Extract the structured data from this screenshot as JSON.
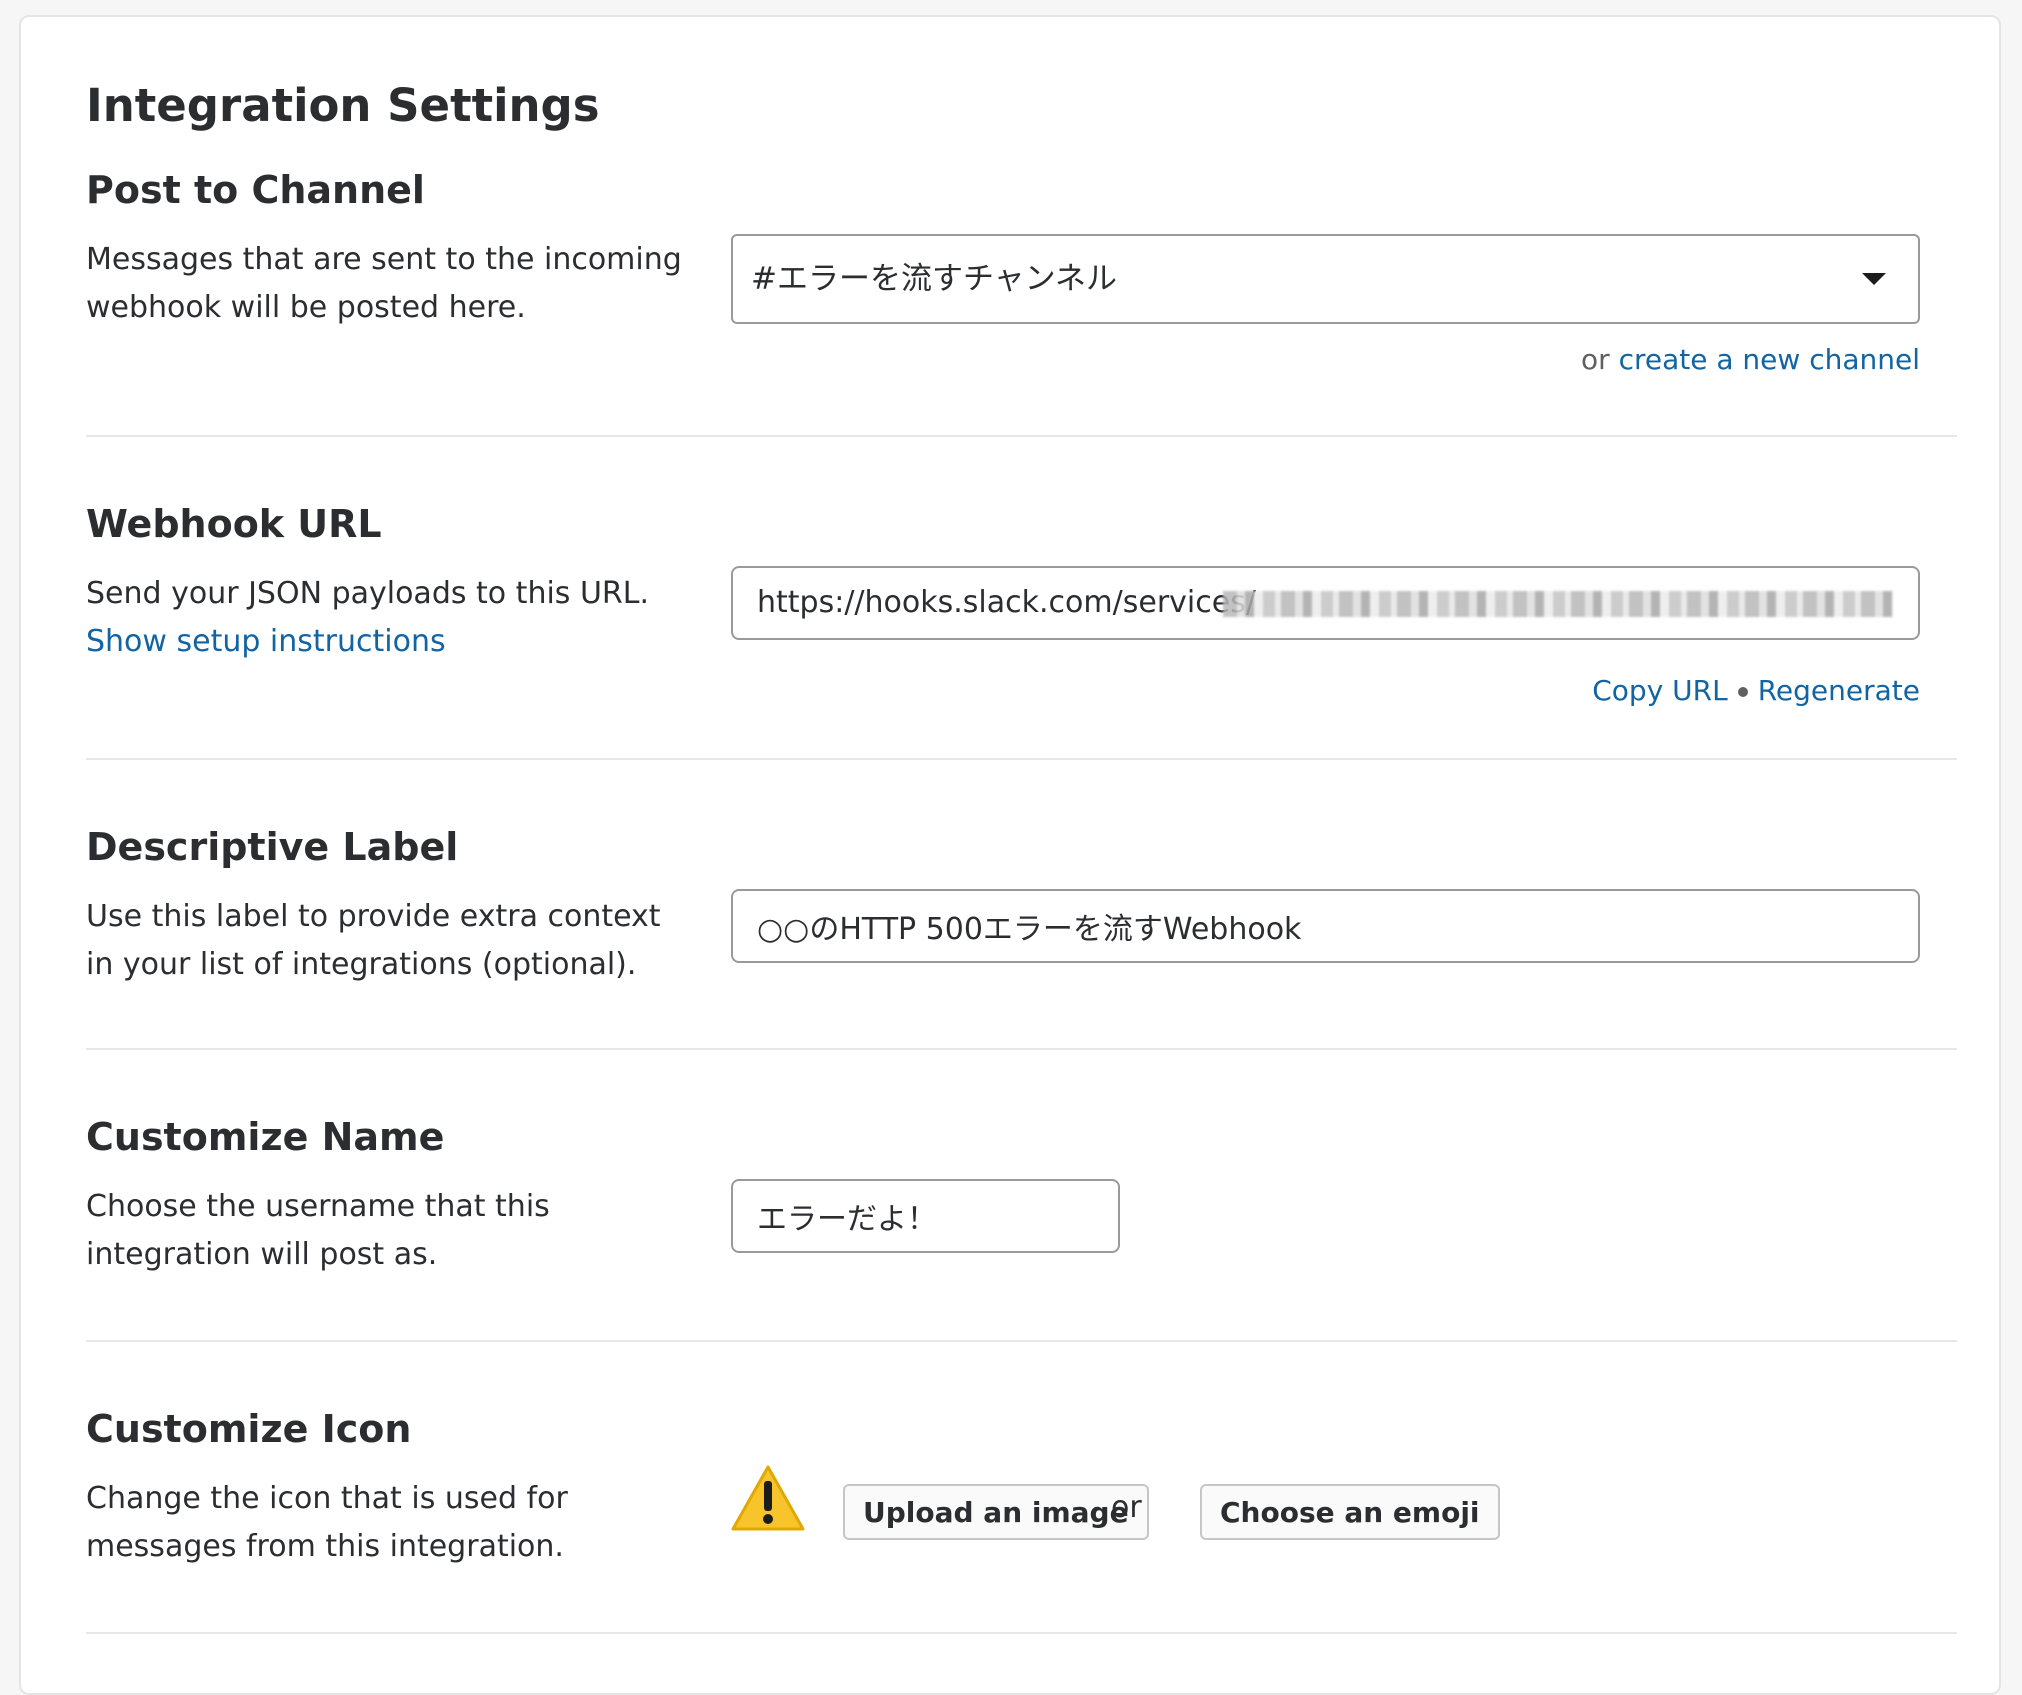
{
  "page": {
    "title": "Integration Settings"
  },
  "post_to_channel": {
    "title": "Post to Channel",
    "description": "Messages that are sent to the incoming webhook will be posted here.",
    "selected_channel": "#エラーを流すチャンネル",
    "or_text": "or",
    "create_channel_link": "create a new channel"
  },
  "webhook_url": {
    "title": "Webhook URL",
    "description": "Send your JSON payloads to this URL.",
    "setup_link": "Show setup instructions",
    "url_prefix": "https://hooks.slack.com/services/",
    "copy_link": "Copy URL",
    "regenerate_link": "Regenerate"
  },
  "descriptive_label": {
    "title": "Descriptive Label",
    "description": "Use this label to provide extra context in your list of integrations (optional).",
    "value": "○○のHTTP 500エラーを流すWebhook"
  },
  "customize_name": {
    "title": "Customize Name",
    "description": "Choose the username that this integration will post as.",
    "value": "エラーだよ！"
  },
  "customize_icon": {
    "title": "Customize Icon",
    "description": "Change the icon that is used for messages from this integration.",
    "icon": "warning-icon",
    "upload_button": "Upload an image",
    "or_text": "or",
    "emoji_button": "Choose an emoji"
  },
  "colors": {
    "link": "#1264a3",
    "text": "#2c2d30",
    "border": "#9a9a9a",
    "warning": "#f7c52b"
  }
}
